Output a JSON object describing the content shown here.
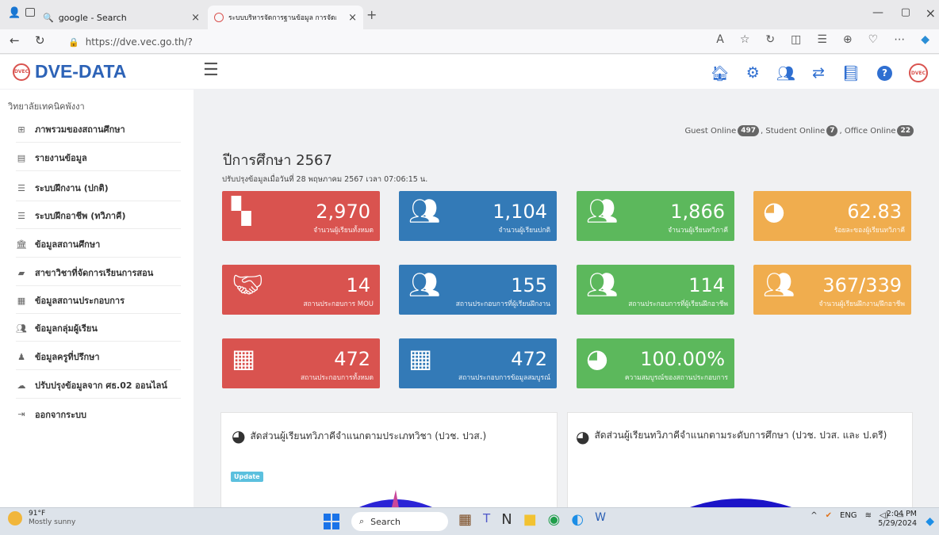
{
  "browser": {
    "tabs": [
      {
        "label": "google - Search"
      },
      {
        "label": "ระบบบริหารจัดการฐานข้อมูล การจัดกา"
      }
    ],
    "url": "https://dve.vec.go.th/?",
    "new_tab": "+"
  },
  "app": {
    "brand": "DVE-DATA",
    "logo_text": "DVEC",
    "college": "วิทยาลัยเทคนิคพังงา",
    "header_icons": [
      "home-icon",
      "gear-icon",
      "users-icon",
      "exchange-icon",
      "book-icon",
      "help-icon",
      "logo-icon"
    ]
  },
  "sidebar": {
    "items": [
      {
        "label": "ภาพรวมของสถานศึกษา",
        "icon": "grid-icon"
      },
      {
        "label": "รายงานข้อมูล",
        "icon": "file-icon"
      },
      {
        "label": "ระบบฝึกงาน (ปกติ)",
        "icon": "list-icon"
      },
      {
        "label": "ระบบฝึกอาชีพ (ทวิภาคี)",
        "icon": "list-icon"
      },
      {
        "label": "ข้อมูลสถานศึกษา",
        "icon": "bank-icon"
      },
      {
        "label": "สาขาวิชาที่จัดการเรียนการสอน",
        "icon": "book-icon"
      },
      {
        "label": "ข้อมูลสถานประกอบการ",
        "icon": "building-icon"
      },
      {
        "label": "ข้อมูลกลุ่มผู้เรียน",
        "icon": "users-icon"
      },
      {
        "label": "ข้อมูลครูที่ปรึกษา",
        "icon": "teacher-icon"
      },
      {
        "label": "ปรับปรุงข้อมูลจาก ศธ.02 ออนไลน์",
        "icon": "cloud-icon"
      },
      {
        "label": "ออกจากระบบ",
        "icon": "logout-icon"
      }
    ]
  },
  "main": {
    "year_title": "ปีการศึกษา 2567",
    "updated": "ปรับปรุงข้อมูลเมื่อวันที่ 28 พฤษภาคม 2567 เวลา 07:06:15 น.",
    "online": {
      "guest_label": "Guest Online",
      "guest": "497",
      "student_label": ", Student Online",
      "student": "7",
      "office_label": ", Office Online",
      "office": "22"
    },
    "cards": [
      {
        "value": "2,970",
        "label": "จำนวนผู้เรียนทั้งหมด",
        "color": "#d9534f",
        "icon": "grid-icon"
      },
      {
        "value": "1,104",
        "label": "จำนวนผู้เรียนปกติ",
        "color": "#337ab7",
        "icon": "users-icon"
      },
      {
        "value": "1,866",
        "label": "จำนวนผู้เรียนทวิภาคี",
        "color": "#5cb85c",
        "icon": "users-icon"
      },
      {
        "value": "62.83",
        "label": "ร้อยละของผู้เรียนทวิภาคี",
        "color": "#f0ad4e",
        "icon": "pie-icon"
      },
      {
        "value": "14",
        "label": "สถานประกอบการ MOU",
        "color": "#d9534f",
        "icon": "handshake-icon"
      },
      {
        "value": "155",
        "label": "สถานประกอบการที่ผู้เรียนฝึกงาน",
        "color": "#337ab7",
        "icon": "users-icon"
      },
      {
        "value": "114",
        "label": "สถานประกอบการที่ผู้เรียนฝึกอาชีพ",
        "color": "#5cb85c",
        "icon": "users-icon"
      },
      {
        "value": "367/339",
        "label": "จำนวนผู้เรียนฝึกงาน/ฝึกอาชีพ",
        "color": "#f0ad4e",
        "icon": "users-icon"
      },
      {
        "value": "472",
        "label": "สถานประกอบการทั้งหมด",
        "color": "#d9534f",
        "icon": "building-icon"
      },
      {
        "value": "472",
        "label": "สถานประกอบการข้อมูลสมบูรณ์",
        "color": "#337ab7",
        "icon": "building-icon"
      },
      {
        "value": "100.00%",
        "label": "ความสมบูรณ์ของสถานประกอบการ",
        "color": "#5cb85c",
        "icon": "pie-icon"
      }
    ],
    "panels": [
      {
        "title": "สัดส่วนผู้เรียนทวิภาคีจำแนกตามประเภทวิชา (ปวช. ปวส.)",
        "badge": "Update"
      },
      {
        "title": "สัดส่วนผู้เรียนทวิภาคีจำแนกตามระดับการศึกษา (ปวช. ปวส. และ ป.ตรี)"
      }
    ]
  },
  "taskbar": {
    "weather_temp": "91°F",
    "weather_desc": "Mostly sunny",
    "search": "Search",
    "lang": "ENG",
    "time": "2:04 PM",
    "date": "5/29/2024"
  }
}
